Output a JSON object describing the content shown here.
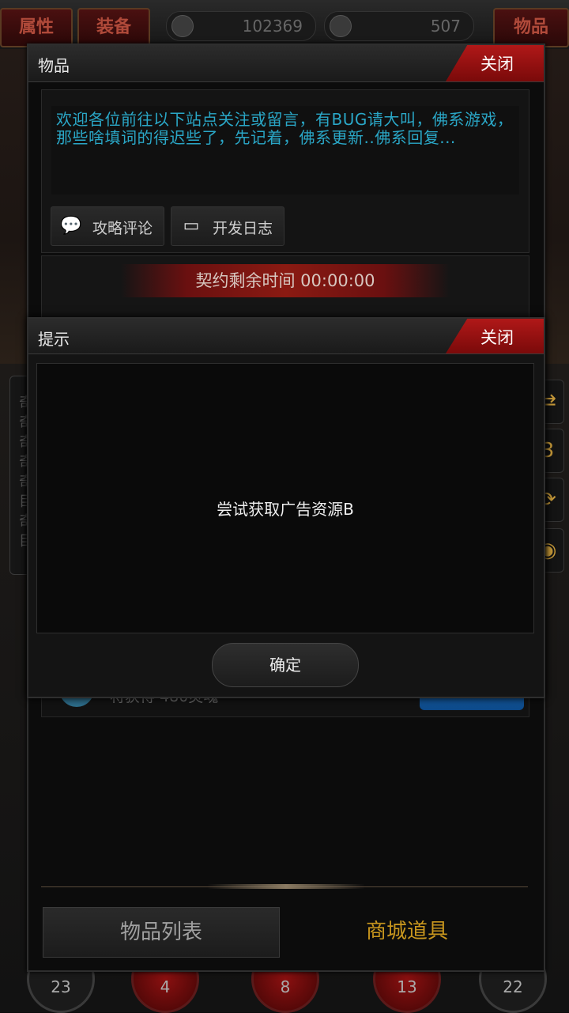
{
  "topbar": {
    "left_tabs": [
      "属性",
      "装备"
    ],
    "right_tab": "物品",
    "currency_1": "102369",
    "currency_2": "507"
  },
  "background": {
    "side_chars": [
      "奇",
      "奇",
      "奇",
      "奇",
      "奇",
      "目",
      "奇",
      "目"
    ],
    "bottom_counts": [
      "23",
      "4",
      "8",
      "13",
      "22"
    ],
    "right_buttons": [
      "⇄",
      "3",
      "⟳",
      "◉"
    ]
  },
  "item_panel": {
    "title": "物品",
    "close_label": "关闭",
    "notice": "欢迎各位前往以下站点关注或留言，有BUG请大叫，佛系游戏，那些啥填词的得迟些了，先记着，佛系更新..佛系回复...",
    "link_guide": "攻略评论",
    "link_devlog": "开发日志",
    "contract_time": "契约剩余时间 00:00:00",
    "reward_text": "将获得 480灵魂",
    "tab_items": "物品列表",
    "tab_shop": "商城道具"
  },
  "dialog": {
    "title": "提示",
    "close_label": "关闭",
    "message": "尝试获取广告资源B",
    "ok_label": "确定"
  },
  "colors": {
    "accent_red": "#b01818",
    "notice_blue": "#2aa7c7",
    "shop_gold": "#c8961e"
  }
}
